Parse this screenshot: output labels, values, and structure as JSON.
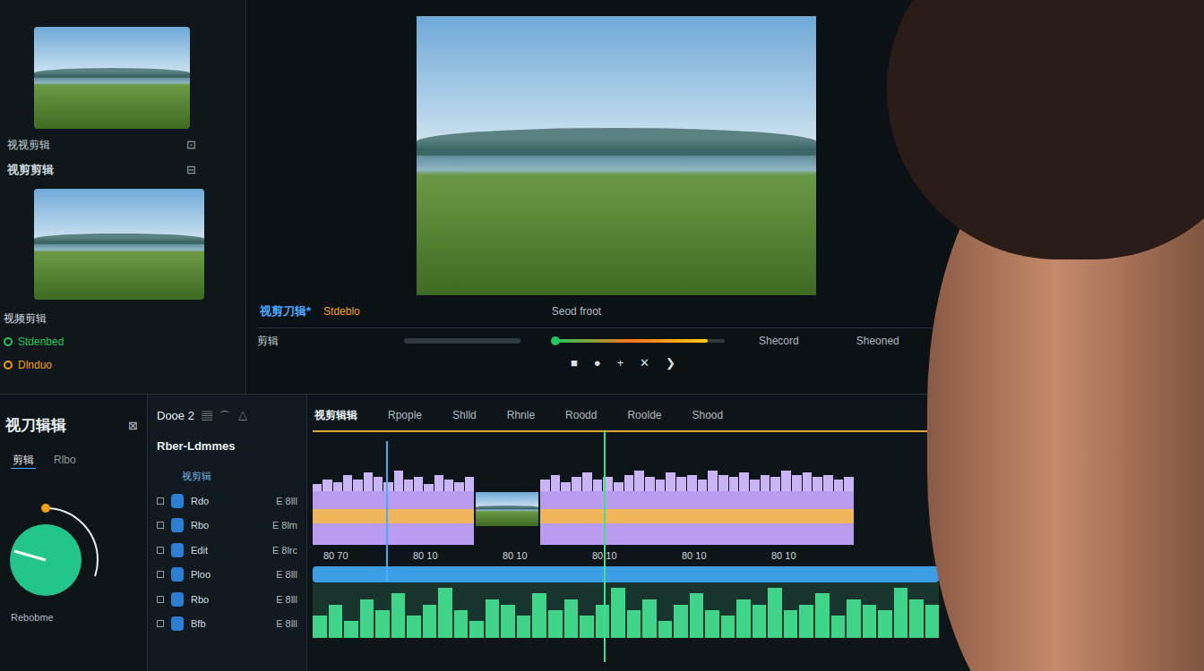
{
  "library": {
    "rows": [
      {
        "label": "视视剪辑",
        "icon": "⊡"
      },
      {
        "label": "视剪剪辑",
        "icon": "⊟"
      }
    ],
    "section": "视频剪辑",
    "options": [
      {
        "label": "Stdenbed",
        "color": "#22c55e"
      },
      {
        "label": "Dlnduo",
        "color": "#f59e0b"
      }
    ]
  },
  "preview": {
    "title": "视剪刀辑*",
    "subtitle": "Stdeblo",
    "label": "Seod froot",
    "track_label": "剪辑",
    "scrub": {
      "level": 0.9
    },
    "readouts": [
      "Shecord",
      "Sheoned"
    ],
    "controls": [
      "■",
      "●",
      "+",
      "✕",
      "❯"
    ]
  },
  "tools": {
    "title": "视刀辑辑",
    "icon": "⊠",
    "tabs": [
      {
        "label": "剪辑",
        "selected": true
      },
      {
        "label": "Rlbo",
        "selected": false
      }
    ],
    "dial": {
      "level": 0.3
    },
    "footer": "Rebobme"
  },
  "layers": {
    "title": "Dooe 2",
    "icons": [
      "▤",
      "⌒",
      "△"
    ],
    "subtitle": "Rber-Ldmmes",
    "section": "视剪辑",
    "items": [
      {
        "label": "Rdo",
        "value": "E 8lll"
      },
      {
        "label": "Rbo",
        "value": "E 8lm"
      },
      {
        "label": "Edit",
        "value": "E 8lrc"
      },
      {
        "label": "Ploo",
        "value": "E 8lll"
      },
      {
        "label": "Rbo",
        "value": "E 8lll"
      },
      {
        "label": "Bfb",
        "value": "E 8lll"
      }
    ]
  },
  "timeline": {
    "headers": [
      "视剪辑辑",
      "Rpople",
      "Shlld",
      "Rhnle",
      "Roodd",
      "Roolde",
      "Shood"
    ],
    "ticks": [
      "80 70",
      "80 10",
      "80 10",
      "80 10",
      "80 10",
      "80 10"
    ],
    "playhead": {
      "level": 0.47
    },
    "clip_a": [
      0.3,
      0.5,
      0.4,
      0.7,
      0.5,
      0.8,
      0.6,
      0.4,
      0.9,
      0.5,
      0.6,
      0.3,
      0.7,
      0.5,
      0.4,
      0.6
    ],
    "clip_b": [
      0.5,
      0.7,
      0.4,
      0.6,
      0.8,
      0.5,
      0.6,
      0.4,
      0.7,
      0.9,
      0.6,
      0.5,
      0.8,
      0.6,
      0.7,
      0.5,
      0.9,
      0.7,
      0.6,
      0.8,
      0.5,
      0.7,
      0.6,
      0.9,
      0.7,
      0.8,
      0.6,
      0.7,
      0.5,
      0.6
    ],
    "audio": [
      0.4,
      0.6,
      0.3,
      0.7,
      0.5,
      0.8,
      0.4,
      0.6,
      0.9,
      0.5,
      0.3,
      0.7,
      0.6,
      0.4,
      0.8,
      0.5,
      0.7,
      0.4,
      0.6,
      0.9,
      0.5,
      0.7,
      0.3,
      0.6,
      0.8,
      0.5,
      0.4,
      0.7,
      0.6,
      0.9,
      0.5,
      0.6,
      0.8,
      0.4,
      0.7,
      0.6,
      0.5,
      0.9,
      0.7,
      0.6
    ]
  }
}
